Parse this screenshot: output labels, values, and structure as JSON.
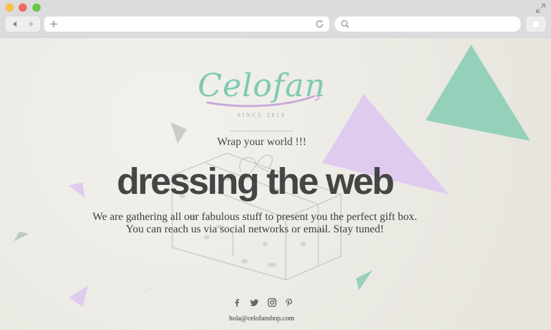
{
  "browser": {
    "url_value": "",
    "search_value": ""
  },
  "icons": [
    "close-dot",
    "minimize-dot",
    "maximize-dot",
    "fullscreen-icon",
    "back-arrow-icon",
    "forward-arrow-icon",
    "plus-icon",
    "reload-icon",
    "search-icon",
    "extension-icon",
    "facebook-icon",
    "twitter-icon",
    "instagram-icon",
    "pinterest-icon",
    "gift-box-illustration"
  ],
  "colors": {
    "logo": "#7fc9b3",
    "accent_purple": "#dfc8ef",
    "accent_mint": "#8ecfb8",
    "headline": "#454545"
  },
  "page": {
    "logo": {
      "wordmark": "Celofan",
      "since": "SINCE 2010"
    },
    "tagline": "Wrap your world !!!",
    "headline": "dressing the web",
    "intro": {
      "line1": "We are gathering all our fabulous stuff to present you the perfect gift box.",
      "line2": "You can reach us via social networks or email. Stay tuned!"
    },
    "contact": {
      "email": "hola@celofanshop.com"
    }
  }
}
